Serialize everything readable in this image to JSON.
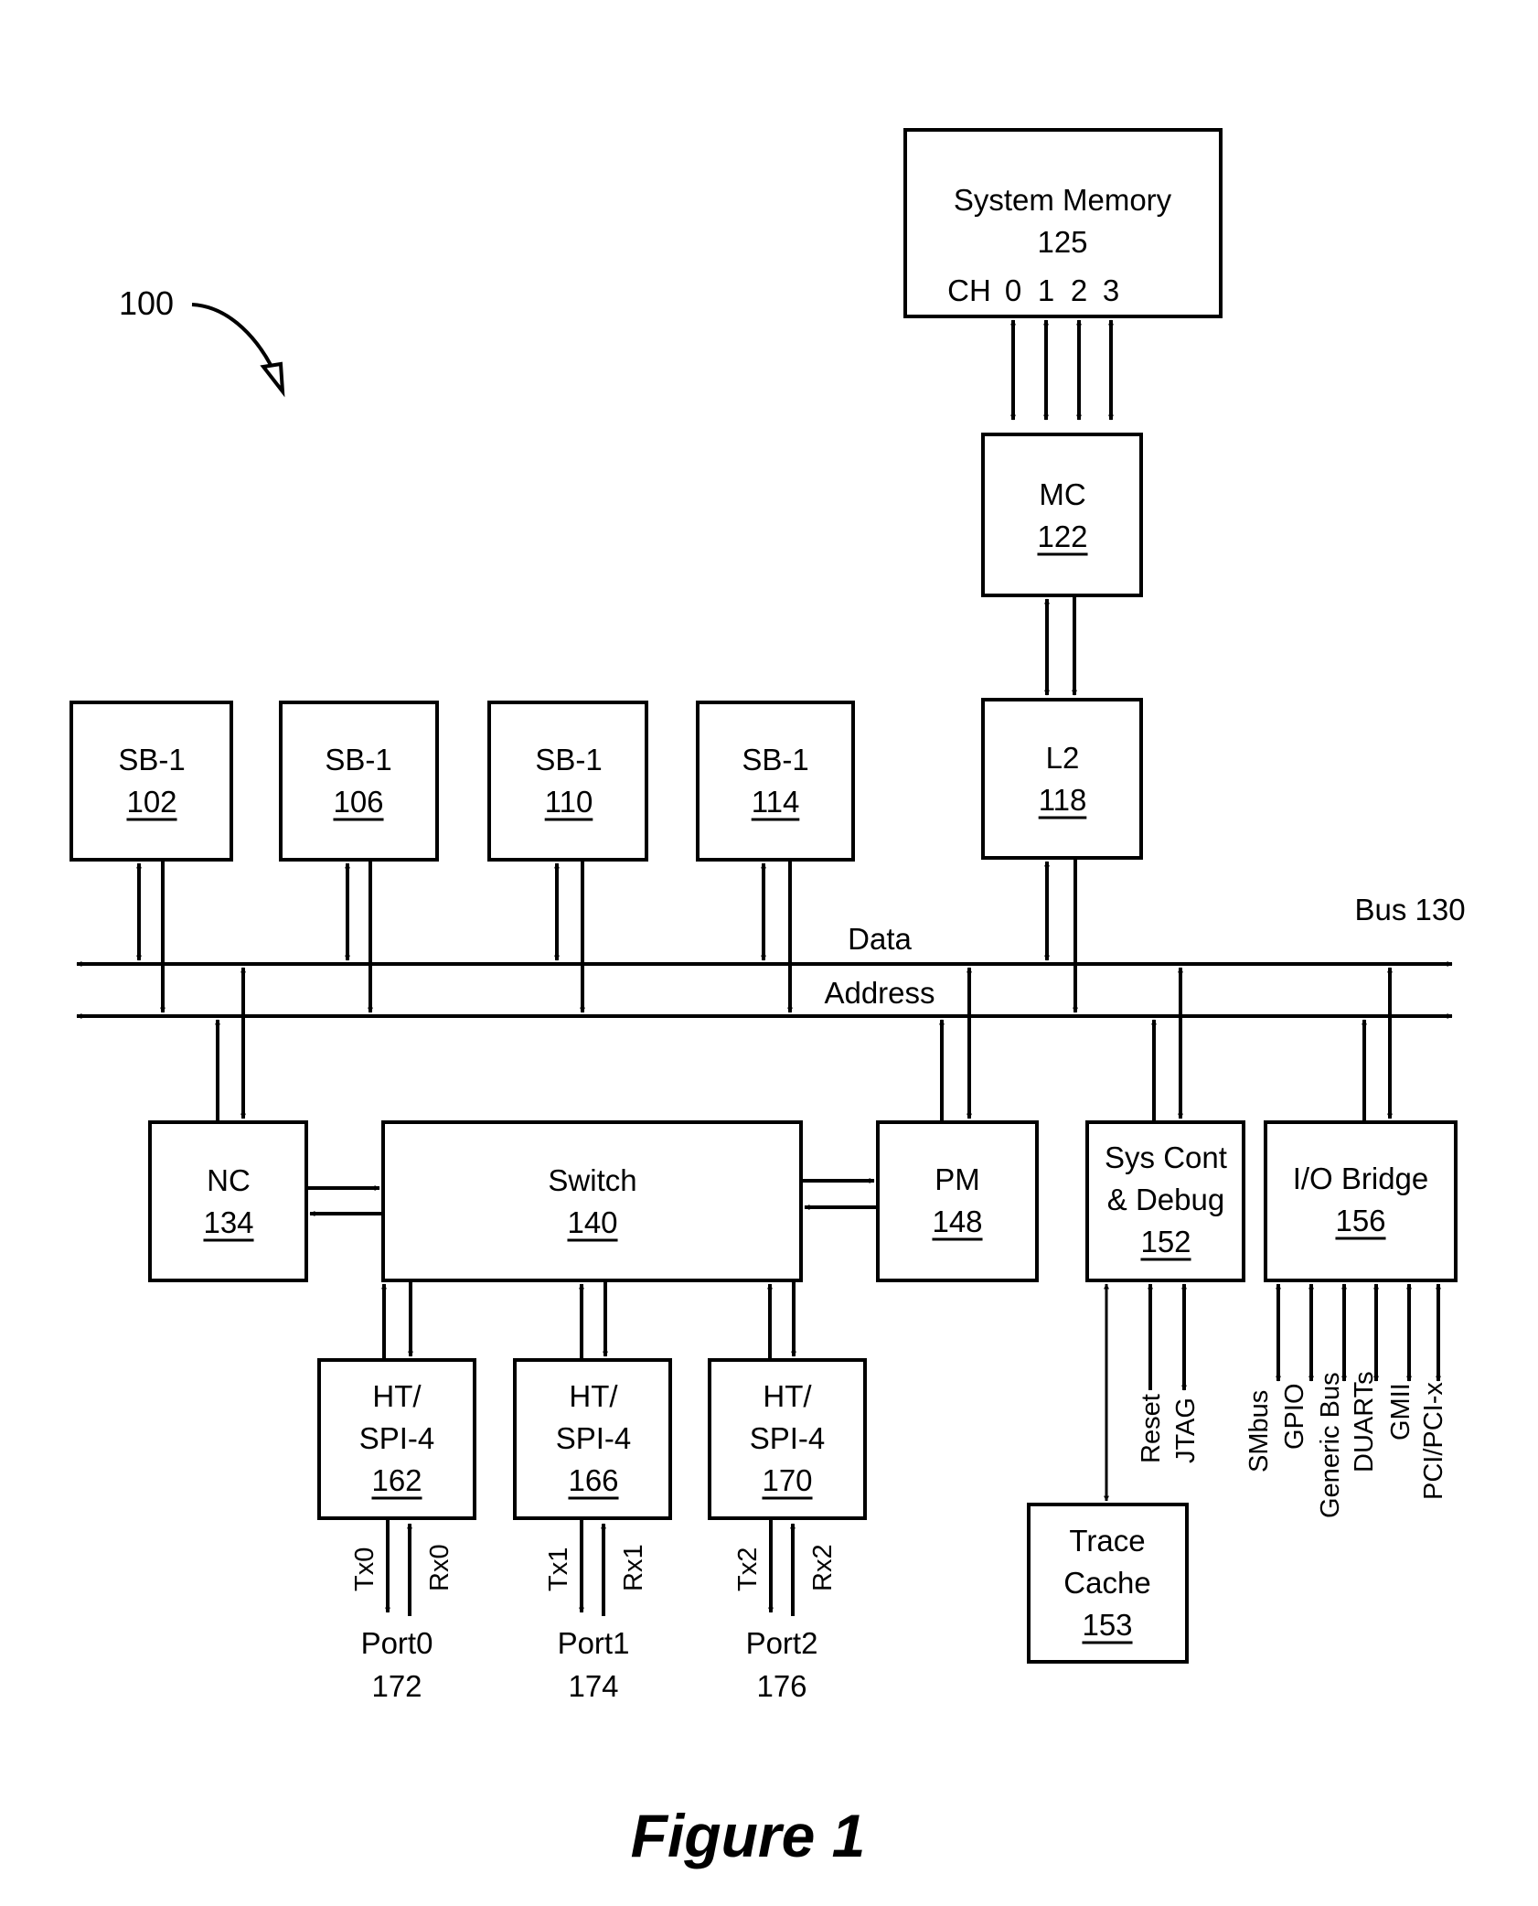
{
  "figure": {
    "reference": "100",
    "caption": "Figure 1"
  },
  "bus": {
    "label": "Bus 130",
    "data_label": "Data",
    "address_label": "Address"
  },
  "blocks": {
    "system_memory": {
      "title": "System Memory",
      "number": "125",
      "channels_label": "CH",
      "channels": [
        "0",
        "1",
        "2",
        "3"
      ]
    },
    "mc": {
      "title": "MC",
      "number": "122"
    },
    "l2": {
      "title": "L2",
      "number": "118"
    },
    "sb1_102": {
      "title": "SB-1",
      "number": "102"
    },
    "sb1_106": {
      "title": "SB-1",
      "number": "106"
    },
    "sb1_110": {
      "title": "SB-1",
      "number": "110"
    },
    "sb1_114": {
      "title": "SB-1",
      "number": "114"
    },
    "nc": {
      "title": "NC",
      "number": "134"
    },
    "switch": {
      "title": "Switch",
      "number": "140"
    },
    "pm": {
      "title": "PM",
      "number": "148"
    },
    "sys_cont": {
      "title_line1": "Sys Cont",
      "title_line2": "& Debug",
      "number": "152"
    },
    "io_bridge": {
      "title": "I/O Bridge",
      "number": "156"
    },
    "trace_cache": {
      "title_line1": "Trace",
      "title_line2": "Cache",
      "number": "153"
    },
    "ht_162": {
      "title_line1": "HT/",
      "title_line2": "SPI-4",
      "number": "162"
    },
    "ht_166": {
      "title_line1": "HT/",
      "title_line2": "SPI-4",
      "number": "166"
    },
    "ht_170": {
      "title_line1": "HT/",
      "title_line2": "SPI-4",
      "number": "170"
    }
  },
  "ports": [
    {
      "tx": "Tx0",
      "rx": "Rx0",
      "name": "Port0",
      "number": "172"
    },
    {
      "tx": "Tx1",
      "rx": "Rx1",
      "name": "Port1",
      "number": "174"
    },
    {
      "tx": "Tx2",
      "rx": "Rx2",
      "name": "Port2",
      "number": "176"
    }
  ],
  "sys_cont_signals": [
    "Reset",
    "JTAG"
  ],
  "io_bridge_signals": [
    "SMbus",
    "GPIO",
    "Generic Bus",
    "DUARTs",
    "GMII",
    "PCI/PCI-x"
  ]
}
